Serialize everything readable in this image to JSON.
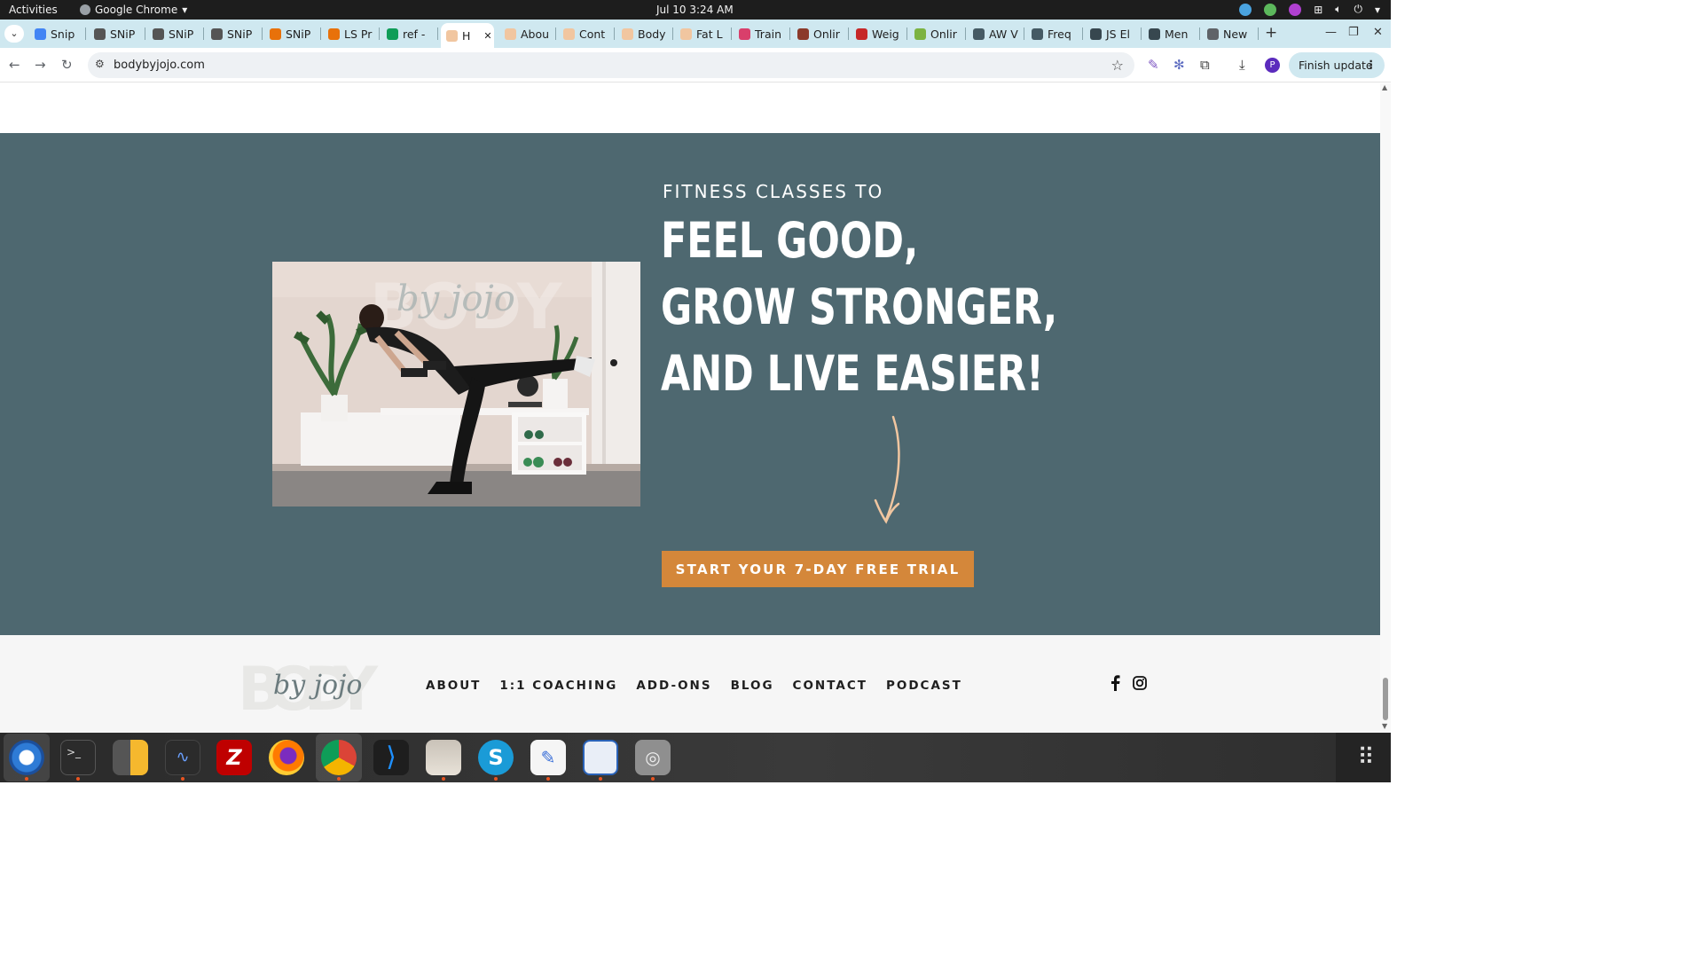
{
  "system": {
    "activities": "Activities",
    "app_name": "Google Chrome",
    "clock": "Jul 10  3:24 AM"
  },
  "tabs": [
    {
      "label": "Snip",
      "color": "#4285f4"
    },
    {
      "label": "SNiP",
      "color": "#555555"
    },
    {
      "label": "SNiP",
      "color": "#555555"
    },
    {
      "label": "SNiP",
      "color": "#555555"
    },
    {
      "label": "SNiP",
      "color": "#e8710a"
    },
    {
      "label": "LS Pr",
      "color": "#e8710a"
    },
    {
      "label": "ref -",
      "color": "#0f9d58"
    },
    {
      "label": "H",
      "color": "#f1c6a0"
    },
    {
      "label": "Abou",
      "color": "#f1c6a0"
    },
    {
      "label": "Cont",
      "color": "#f1c6a0"
    },
    {
      "label": "Body",
      "color": "#f1c6a0"
    },
    {
      "label": "Fat L",
      "color": "#f1c6a0"
    },
    {
      "label": "Train",
      "color": "#d93f6b"
    },
    {
      "label": "Onlir",
      "color": "#8b3a2a"
    },
    {
      "label": "Weig",
      "color": "#c62828"
    },
    {
      "label": "Onlir",
      "color": "#7cb342"
    },
    {
      "label": "AW V",
      "color": "#455a64"
    },
    {
      "label": "Freq",
      "color": "#455a64"
    },
    {
      "label": "JS El",
      "color": "#37474f"
    },
    {
      "label": "Men",
      "color": "#37474f"
    },
    {
      "label": "New",
      "color": "#5f6368"
    }
  ],
  "active_tab_index": 7,
  "omnibox": {
    "url": "bodybyjojo.com"
  },
  "browser": {
    "finish_update": "Finish update",
    "profile_initial": "P"
  },
  "hero": {
    "eyebrow": "FITNESS CLASSES TO",
    "line1": "FEEL GOOD,",
    "line2": "GROW STRONGER,",
    "line3": "AND LIVE EASIER!",
    "cta": "START YOUR 7-DAY FREE TRIAL",
    "photo_logo_word": "BODY",
    "photo_logo_script": "by jojo",
    "colors": {
      "background": "#4e6870",
      "cta": "#d4873a",
      "arrow": "#f1c6a0"
    }
  },
  "footer": {
    "logo_word": "BODY",
    "logo_script": "by jojo",
    "nav": [
      "ABOUT",
      "1:1 COACHING",
      "ADD-ONS",
      "BLOG",
      "CONTACT",
      "PODCAST"
    ],
    "social": [
      "facebook-icon",
      "instagram-icon"
    ]
  },
  "dock": [
    "thunderbird-icon",
    "terminal-icon",
    "calculator-icon",
    "system-monitor-icon",
    "filezilla-icon",
    "firefox-icon",
    "chrome-icon",
    "vscode-icon",
    "files-icon",
    "skype-icon",
    "text-editor-icon",
    "writer-icon",
    "disk-icon",
    "app-grid-icon"
  ]
}
